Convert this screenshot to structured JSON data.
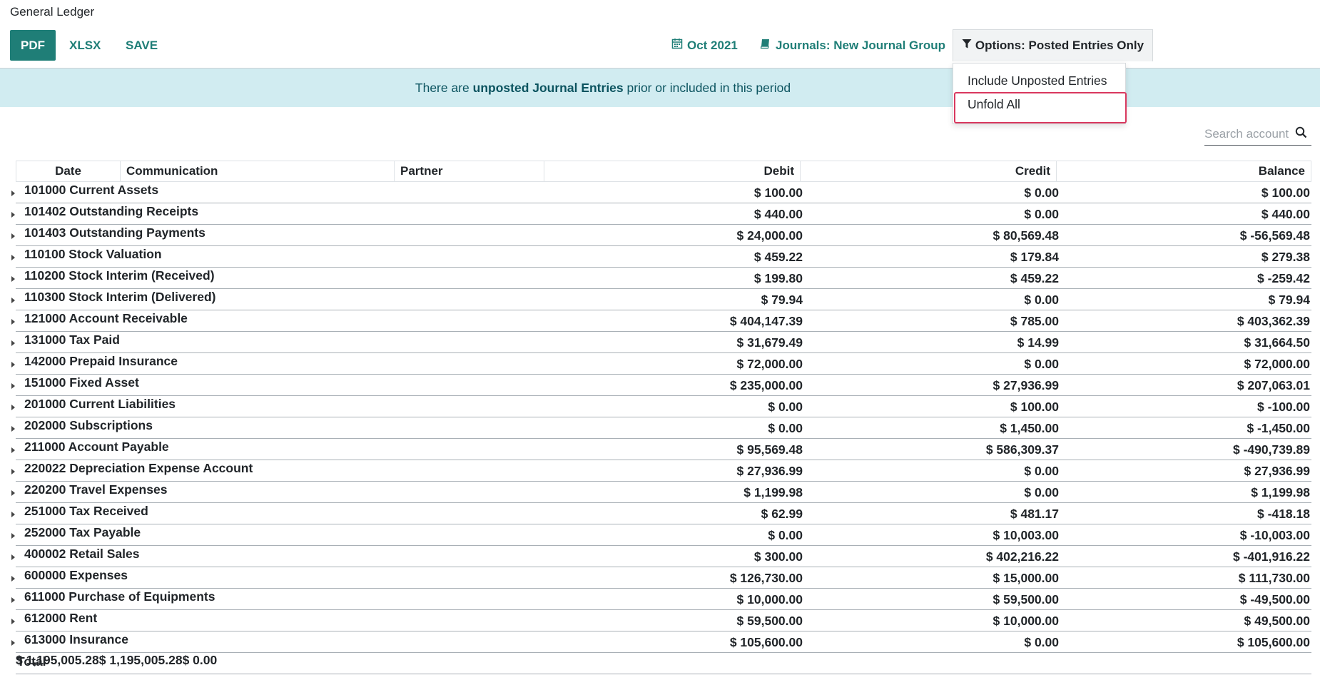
{
  "page_title": "General Ledger",
  "toolbar": {
    "pdf_label": "PDF",
    "xlsx_label": "XLSX",
    "save_label": "SAVE",
    "date_filter": "Oct 2021",
    "journals_filter": "Journals: New Journal Group",
    "options_filter": "Options: Posted Entries Only"
  },
  "alert": {
    "prefix": "There are ",
    "strong": "unposted Journal Entries",
    "suffix": " prior or included in this period"
  },
  "options_dropdown": {
    "items": [
      "Include Unposted Entries",
      "Unfold All"
    ],
    "highlighted": "Unfold All"
  },
  "search": {
    "placeholder": "Search account"
  },
  "colors": {
    "primary": "#1f7e77",
    "alert_bg": "#d1ecf1",
    "alert_text": "#0c5460",
    "highlight": "#d9385e"
  },
  "table": {
    "columns": [
      "Date",
      "Communication",
      "Partner",
      "Debit",
      "Credit",
      "Balance"
    ],
    "rows": [
      {
        "account": "101000 Current Assets",
        "debit": "$ 100.00",
        "credit": "$ 0.00",
        "balance": "$ 100.00"
      },
      {
        "account": "101402 Outstanding Receipts",
        "debit": "$ 440.00",
        "credit": "$ 0.00",
        "balance": "$ 440.00"
      },
      {
        "account": "101403 Outstanding Payments",
        "debit": "$ 24,000.00",
        "credit": "$ 80,569.48",
        "balance": "$ -56,569.48"
      },
      {
        "account": "110100 Stock Valuation",
        "debit": "$ 459.22",
        "credit": "$ 179.84",
        "balance": "$ 279.38"
      },
      {
        "account": "110200 Stock Interim (Received)",
        "debit": "$ 199.80",
        "credit": "$ 459.22",
        "balance": "$ -259.42"
      },
      {
        "account": "110300 Stock Interim (Delivered)",
        "debit": "$ 79.94",
        "credit": "$ 0.00",
        "balance": "$ 79.94"
      },
      {
        "account": "121000 Account Receivable",
        "debit": "$ 404,147.39",
        "credit": "$ 785.00",
        "balance": "$ 403,362.39"
      },
      {
        "account": "131000 Tax Paid",
        "debit": "$ 31,679.49",
        "credit": "$ 14.99",
        "balance": "$ 31,664.50"
      },
      {
        "account": "142000 Prepaid Insurance",
        "debit": "$ 72,000.00",
        "credit": "$ 0.00",
        "balance": "$ 72,000.00"
      },
      {
        "account": "151000 Fixed Asset",
        "debit": "$ 235,000.00",
        "credit": "$ 27,936.99",
        "balance": "$ 207,063.01"
      },
      {
        "account": "201000 Current Liabilities",
        "debit": "$ 0.00",
        "credit": "$ 100.00",
        "balance": "$ -100.00"
      },
      {
        "account": "202000 Subscriptions",
        "debit": "$ 0.00",
        "credit": "$ 1,450.00",
        "balance": "$ -1,450.00"
      },
      {
        "account": "211000 Account Payable",
        "debit": "$ 95,569.48",
        "credit": "$ 586,309.37",
        "balance": "$ -490,739.89"
      },
      {
        "account": "220022 Depreciation Expense Account",
        "debit": "$ 27,936.99",
        "credit": "$ 0.00",
        "balance": "$ 27,936.99"
      },
      {
        "account": "220200 Travel Expenses",
        "debit": "$ 1,199.98",
        "credit": "$ 0.00",
        "balance": "$ 1,199.98"
      },
      {
        "account": "251000 Tax Received",
        "debit": "$ 62.99",
        "credit": "$ 481.17",
        "balance": "$ -418.18"
      },
      {
        "account": "252000 Tax Payable",
        "debit": "$ 0.00",
        "credit": "$ 10,003.00",
        "balance": "$ -10,003.00"
      },
      {
        "account": "400002 Retail Sales",
        "debit": "$ 300.00",
        "credit": "$ 402,216.22",
        "balance": "$ -401,916.22"
      },
      {
        "account": "600000 Expenses",
        "debit": "$ 126,730.00",
        "credit": "$ 15,000.00",
        "balance": "$ 111,730.00"
      },
      {
        "account": "611000 Purchase of Equipments",
        "debit": "$ 10,000.00",
        "credit": "$ 59,500.00",
        "balance": "$ -49,500.00"
      },
      {
        "account": "612000 Rent",
        "debit": "$ 59,500.00",
        "credit": "$ 10,000.00",
        "balance": "$ 49,500.00"
      },
      {
        "account": "613000 Insurance",
        "debit": "$ 105,600.00",
        "credit": "$ 0.00",
        "balance": "$ 105,600.00"
      }
    ],
    "total": {
      "label": "Total",
      "debit": "$ 1,195,005.28",
      "credit": "$ 1,195,005.28",
      "balance": "$ 0.00"
    }
  }
}
